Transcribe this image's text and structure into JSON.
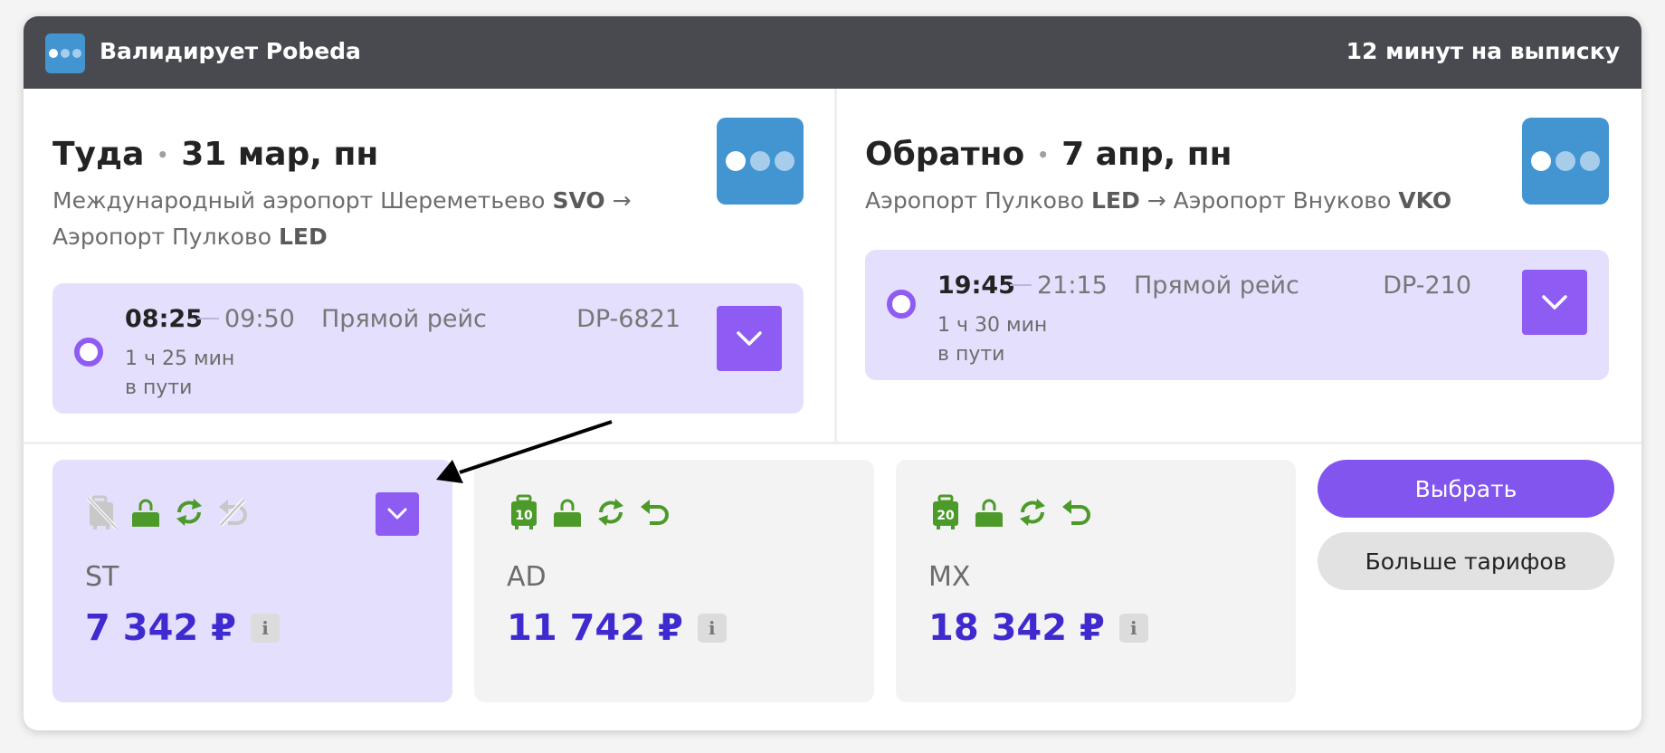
{
  "header": {
    "validator": "Валидирует Pobeda",
    "timer": "12 минут на выписку"
  },
  "outbound": {
    "direction": "Туда",
    "date": "31 мар, пн",
    "route_from": "Международный аэропорт Шереметьево",
    "route_from_code": "SVO",
    "arrow": "→",
    "route_to": "Аэропорт Пулково",
    "route_to_code": "LED",
    "departure": "08:25",
    "arrival": "09:50",
    "type": "Прямой рейс",
    "flight": "DP-6821",
    "duration": "1 ч 25 мин",
    "duration_note": "в пути"
  },
  "return": {
    "direction": "Обратно",
    "date": "7 апр, пн",
    "route_from": "Аэропорт Пулково",
    "route_from_code": "LED",
    "arrow": "→",
    "route_to": "Аэропорт Внуково",
    "route_to_code": "VKO",
    "departure": "19:45",
    "arrival": "21:15",
    "type": "Прямой рейс",
    "flight": "DP-210",
    "duration": "1 ч 30 мин",
    "duration_note": "в пути"
  },
  "tariffs": [
    {
      "name": "ST",
      "price": "7 342 ₽",
      "info": "i",
      "selected": true,
      "icons": [
        "no-baggage-icon",
        "hand-luggage-icon",
        "exchange-icon",
        "no-refund-icon"
      ]
    },
    {
      "name": "AD",
      "price": "11 742 ₽",
      "info": "i",
      "selected": false,
      "baggage_kg": "10",
      "icons": [
        "baggage-10-icon",
        "hand-luggage-icon",
        "exchange-icon",
        "refund-icon"
      ]
    },
    {
      "name": "MX",
      "price": "18 342 ₽",
      "info": "i",
      "selected": false,
      "baggage_kg": "20",
      "icons": [
        "baggage-20-icon",
        "hand-luggage-icon",
        "exchange-icon",
        "refund-icon"
      ]
    }
  ],
  "actions": {
    "select": "Выбрать",
    "more_tariffs": "Больше тарифов"
  },
  "colors": {
    "accent": "#8f5cf3",
    "price": "#3f2ad0",
    "airline": "#4395d2",
    "included": "#4c9a2a",
    "excluded": "#c8c8c8"
  }
}
